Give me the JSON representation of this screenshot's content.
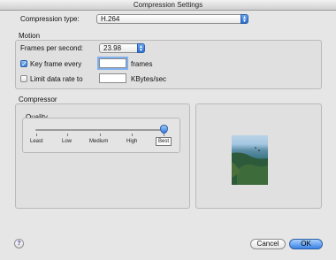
{
  "window": {
    "title": "Compression Settings"
  },
  "compression_type": {
    "label": "Compression type:",
    "value": "H.264"
  },
  "motion": {
    "title": "Motion",
    "fps_label": "Frames per second:",
    "fps_value": "23.98",
    "keyframe_label": "Key frame every",
    "keyframe_checked": true,
    "keyframe_value": "",
    "keyframe_unit": "frames",
    "limit_label": "Limit data rate to",
    "limit_checked": false,
    "limit_value": "",
    "limit_unit": "KBytes/sec"
  },
  "compressor": {
    "title": "Compressor",
    "quality_label": "Quality",
    "quality_value": 1.0,
    "ticks": [
      "Least",
      "Low",
      "Medium",
      "High",
      "Best"
    ],
    "selected_tick": "Best"
  },
  "buttons": {
    "help": "?",
    "cancel": "Cancel",
    "ok": "OK"
  },
  "icons": {
    "popup_arrows": "updown-arrows-icon",
    "check": "checkmark-icon",
    "help": "help-icon"
  }
}
